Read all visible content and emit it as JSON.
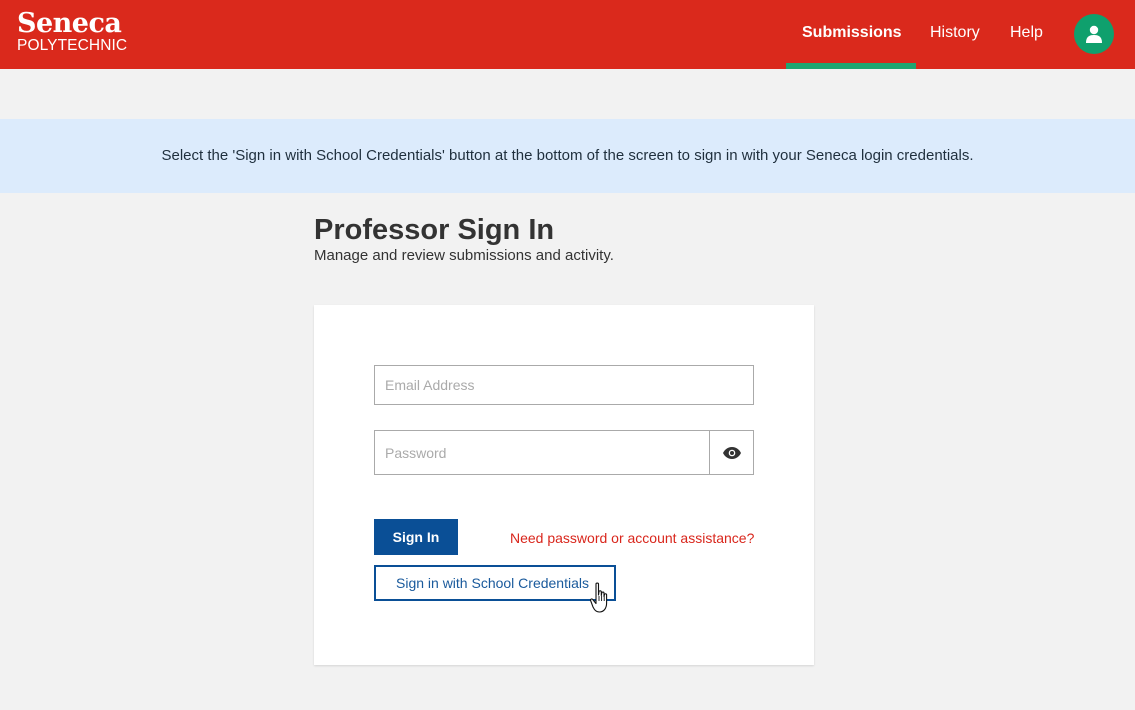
{
  "header": {
    "logo": {
      "main": "Seneca",
      "sub": "POLYTECHNIC"
    },
    "nav": [
      {
        "label": "Submissions",
        "active": true
      },
      {
        "label": "History",
        "active": false
      },
      {
        "label": "Help",
        "active": false
      }
    ],
    "avatar_icon": "user-icon",
    "colors": {
      "bar": "#da291c",
      "accent": "#1ea671",
      "avatar": "#0fa06d"
    }
  },
  "banner": {
    "text": "Select the 'Sign in with School Credentials' button at the bottom of the screen to sign in with your Seneca login credentials."
  },
  "page": {
    "title": "Professor Sign In",
    "subtitle": "Manage and review submissions and activity."
  },
  "form": {
    "email": {
      "value": "",
      "placeholder": "Email Address"
    },
    "password": {
      "value": "",
      "placeholder": "Password"
    },
    "show_password_icon": "eye-icon",
    "sign_in_label": "Sign In",
    "help_link": "Need password or account assistance?",
    "school_credentials_label": "Sign in with School Credentials",
    "colors": {
      "primary": "#0a4f96",
      "link": "#d9261c"
    }
  }
}
